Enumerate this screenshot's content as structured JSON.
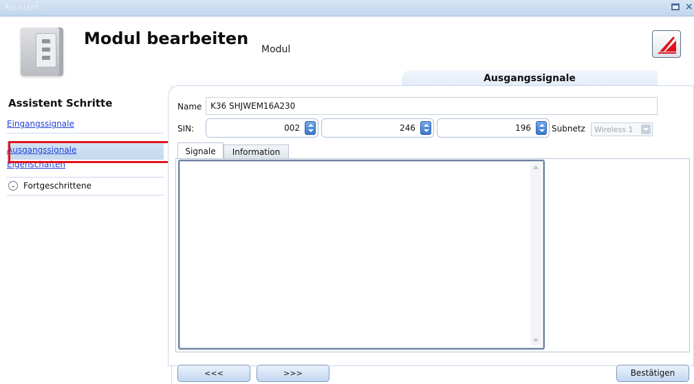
{
  "window": {
    "title": "Assistent..."
  },
  "header": {
    "title": "Modul bearbeiten",
    "subtitle": "Modul",
    "section_tab": "Ausgangssignale"
  },
  "sidebar": {
    "heading": "Assistent Schritte",
    "items": [
      {
        "label": "Eingangssignale",
        "selected": false
      },
      {
        "label": "Ausgangssignale",
        "selected": true
      },
      {
        "label": "Eigenschaften",
        "selected": false
      }
    ],
    "advanced_label": "Fortgeschrittene"
  },
  "form": {
    "name_label": "Name",
    "name_value": "K36 SHJWEM16A230",
    "sin_label": "SIN:",
    "sin_values": [
      "002",
      "246",
      "196"
    ],
    "subnet_label": "Subnetz",
    "subnet_value": "Wireless 1"
  },
  "tabs": [
    {
      "label": "Signale",
      "active": true
    },
    {
      "label": "Information",
      "active": false
    }
  ],
  "buttons": {
    "prev": "<<<",
    "next": ">>>",
    "confirm": "Bestätigen"
  },
  "colors": {
    "accent_blue": "#3b77c9",
    "highlight_red": "#e3111b",
    "link_blue": "#1f3fd6"
  }
}
